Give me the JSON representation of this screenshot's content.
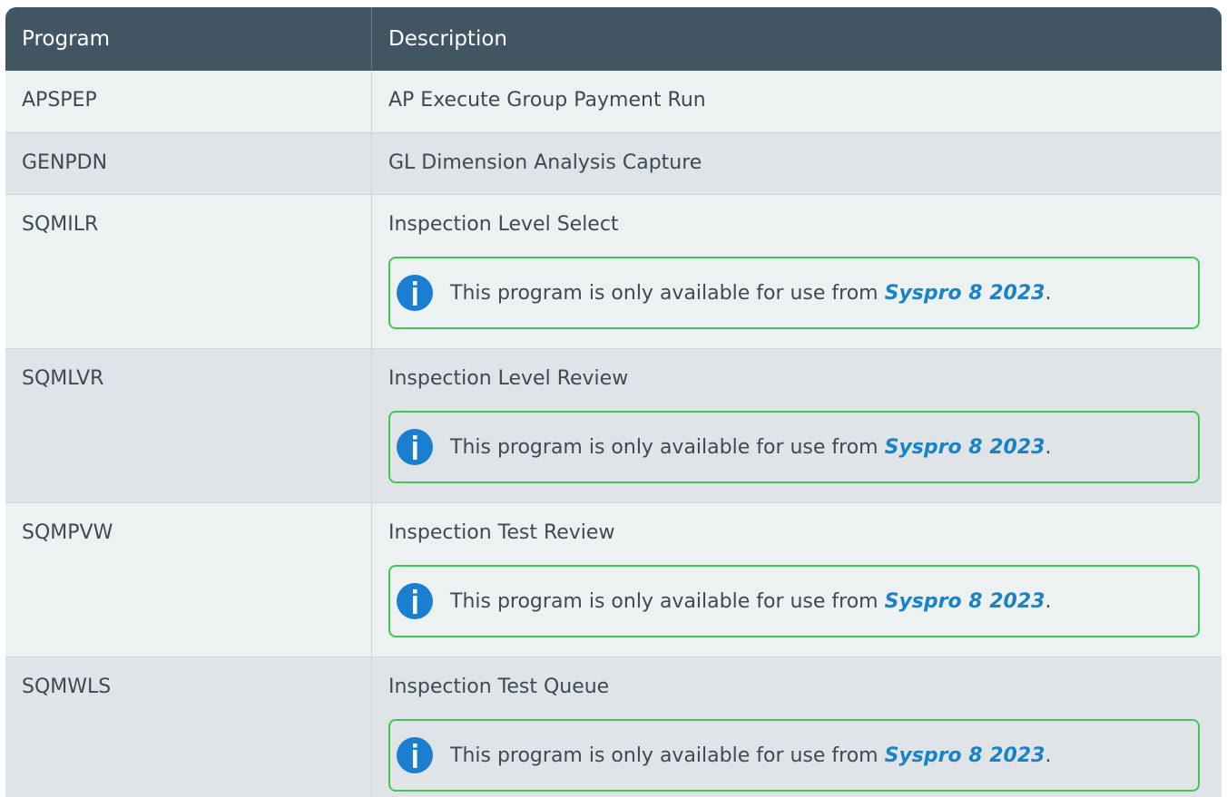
{
  "header": {
    "program": "Program",
    "description": "Description"
  },
  "rows": [
    {
      "program": "APSPEP",
      "description": "AP Execute Group Payment Run"
    },
    {
      "program": "GENPDN",
      "description": "GL Dimension Analysis Capture"
    },
    {
      "program": "SQMILR",
      "description": "Inspection Level Select",
      "note": {
        "text_before": "This program is only available for use from ",
        "link": "Syspro 8 2023",
        "text_after": "."
      }
    },
    {
      "program": "SQMLVR",
      "description": "Inspection Level Review",
      "note": {
        "text_before": "This program is only available for use from ",
        "link": "Syspro 8 2023",
        "text_after": "."
      }
    },
    {
      "program": "SQMPVW",
      "description": "Inspection Test Review",
      "note": {
        "text_before": "This program is only available for use from ",
        "link": "Syspro 8 2023",
        "text_after": "."
      }
    },
    {
      "program": "SQMWLS",
      "description": "Inspection Test Queue",
      "note": {
        "text_before": "This program is only available for use from ",
        "link": "Syspro 8 2023",
        "text_after": "."
      }
    }
  ],
  "colors": {
    "header_bg": "#425563",
    "row_light": "#eef1f2",
    "row_dark": "#e0e4e6",
    "note_border": "#3ec85a",
    "link": "#1a83c4",
    "icon": "#1a7fd0"
  },
  "icons": {
    "note": "info-icon"
  }
}
